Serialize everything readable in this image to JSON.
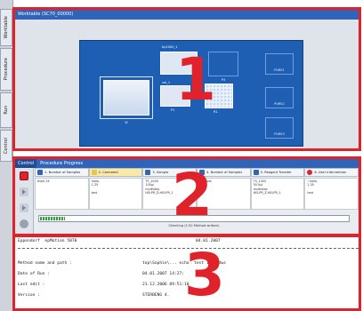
{
  "side_tabs": [
    {
      "label": "Worktable"
    },
    {
      "label": "Procedure"
    },
    {
      "label": "Run"
    },
    {
      "label": "Control"
    }
  ],
  "worktable": {
    "title": "Worktable (SC70_00000)",
    "racks": [
      {
        "label": "tip1000_1"
      },
      {
        "label": "vol_1"
      },
      {
        "label": "P1"
      },
      {
        "label": "R1"
      }
    ],
    "slots": [
      {
        "label": "W"
      },
      {
        "label": "P4"
      },
      {
        "label": "PURE1"
      },
      {
        "label": "PURE2"
      },
      {
        "label": "PURE3"
      }
    ]
  },
  "control": {
    "tab_label": "Control",
    "title": "Procedure Progress",
    "steps": [
      {
        "label": "1. Number of Samples",
        "icon_color": "#2f64b8"
      },
      {
        "label": "2. Comment",
        "icon_color": "#e6c84a"
      },
      {
        "label": "3. Sample",
        "icon_color": "#2f64b8"
      },
      {
        "label": "4. Number of Samples",
        "icon_color": "#2f64b8"
      },
      {
        "label": "5. Reagent Transfer",
        "icon_color": "#2f64b8"
      },
      {
        "label": "6. User Intervention",
        "icon_color": "#e0222b"
      }
    ],
    "cards": [
      "fixed 24",
      "hallo,\n1,35\n\ntext",
      "TS_1000\n100µl\nmultistep\nHELPR_D-HELPR_1",
      "variable",
      "TS_1000\n50.0µl\nmultistep\nHELPR_Z-HELPR_1",
      "! hallo,\n1,35\n\ntext"
    ],
    "progress_fraction": 0.08,
    "status_text": "Checking (1:52 Method written)"
  },
  "log": {
    "header_left": "Eppendorf  epMotion 5070",
    "header_right": "04.01.2007",
    "rows": [
      {
        "label": "Method name and path :",
        "value": "top\\Sophie\\... echo  test 1\\11.dws"
      },
      {
        "label": "Date of Run :",
        "value": "04.01.2007 14:27:"
      },
      {
        "label": "Last edit :",
        "value": "21.12.2006 09:51:10"
      },
      {
        "label": "Version :",
        "value": "STERBENG 4."
      }
    ]
  },
  "callouts": {
    "one": "1",
    "two": "2",
    "three": "3"
  }
}
